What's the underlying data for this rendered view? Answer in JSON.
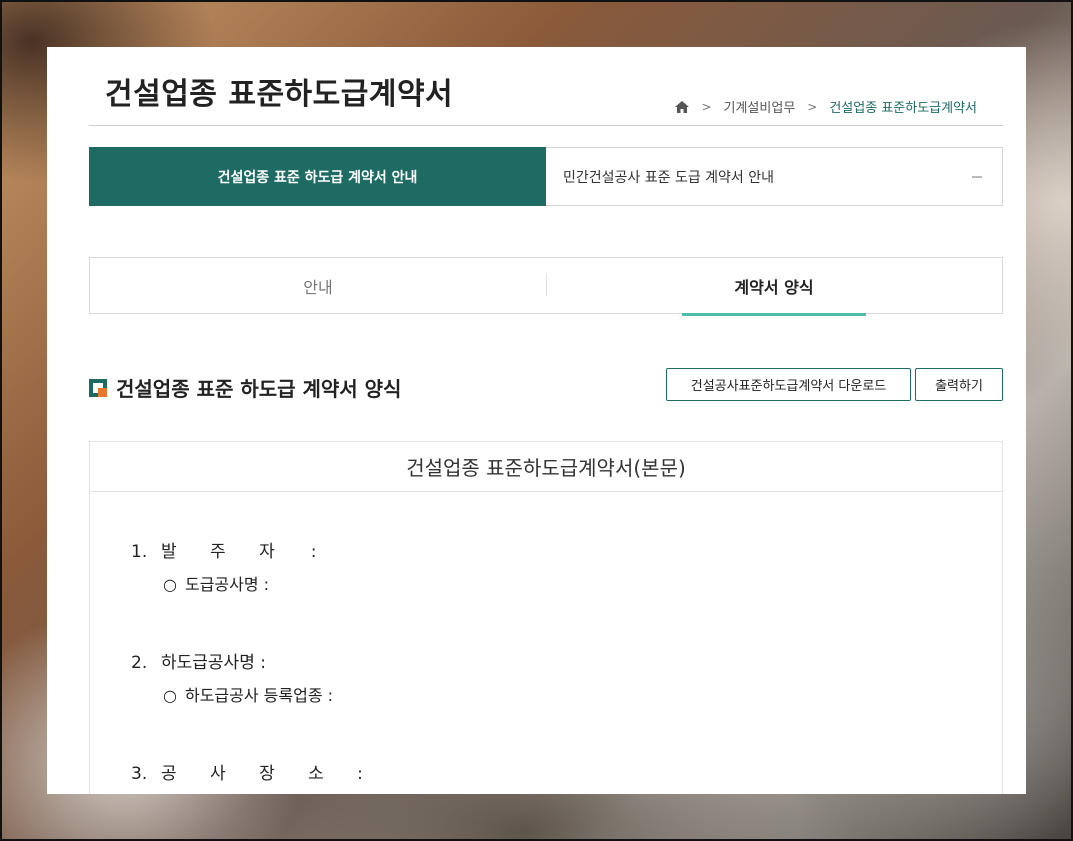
{
  "page": {
    "title": "건설업종 표준하도급계약서"
  },
  "breadcrumb": {
    "home_icon": "home-icon",
    "items": [
      "기계설비업무",
      "건설업종 표준하도급계약서"
    ]
  },
  "main_tabs": {
    "active": "건설업종 표준 하도급 계약서 안내",
    "other": "민간건설공사 표준 도급 계약서 안내",
    "colors": {
      "active_bg": "#1d6b62"
    }
  },
  "sub_tabs": [
    {
      "label": "안내",
      "active": false
    },
    {
      "label": "계약서 양식",
      "active": true
    }
  ],
  "section": {
    "title": "건설업종 표준 하도급 계약서 양식",
    "download_label": "건설공사표준하도급계약서 다운로드",
    "print_label": "출력하기"
  },
  "document": {
    "title": "건설업종 표준하도급계약서(본문)",
    "items": [
      {
        "num": "1.",
        "label": "발 주 자",
        "colon": ":",
        "sub": "도급공사명 :"
      },
      {
        "num": "2.",
        "label": "하도급공사명 :",
        "sub": "하도급공사 등록업종 :"
      },
      {
        "num": "3.",
        "label": "공 사 장 소 :"
      }
    ],
    "bullet": "○"
  },
  "colors": {
    "accent": "#1d6b62",
    "underline": "#4dbdaa",
    "icon_orange": "#e8772e"
  }
}
